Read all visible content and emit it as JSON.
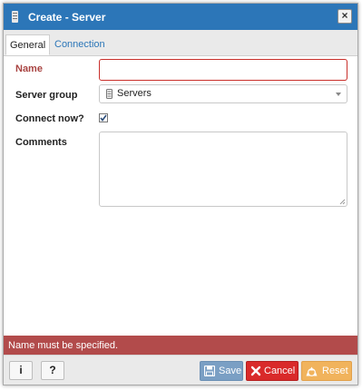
{
  "dialog": {
    "title": "Create - Server",
    "close_label": "×"
  },
  "tabs": [
    {
      "label": "General",
      "active": true
    },
    {
      "label": "Connection",
      "active": false
    }
  ],
  "form": {
    "name_label": "Name",
    "name_value": "",
    "server_group_label": "Server group",
    "server_group_value": "Servers",
    "connect_now_label": "Connect now?",
    "connect_now_checked": true,
    "comments_label": "Comments",
    "comments_value": ""
  },
  "error_message": "Name must be specified.",
  "footer": {
    "info_label": "i",
    "help_label": "?",
    "save_label": "Save",
    "cancel_label": "Cancel",
    "reset_label": "Reset"
  },
  "colors": {
    "titlebar": "#2c76b8",
    "error_bar": "#b24b4b",
    "save": "#7a9fc4",
    "cancel": "#d92a2a",
    "reset": "#f1b35c"
  }
}
